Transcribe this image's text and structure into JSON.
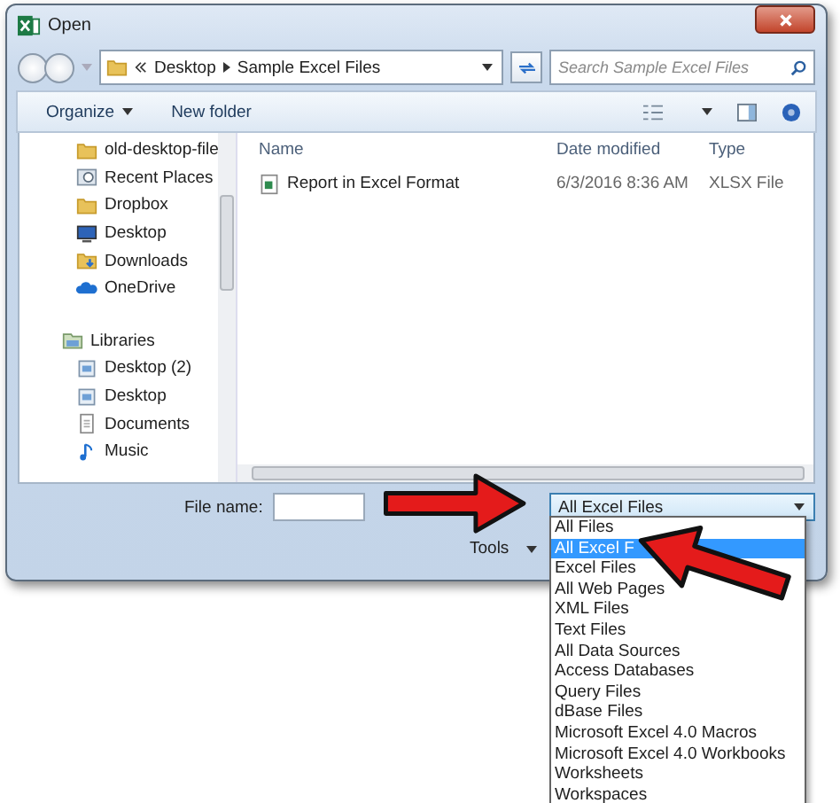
{
  "window": {
    "title": "Open"
  },
  "address": {
    "path": [
      "Desktop",
      "Sample Excel Files"
    ]
  },
  "search": {
    "placeholder": "Search Sample Excel Files"
  },
  "toolbar": [
    "Organize",
    "New folder"
  ],
  "sidebar": {
    "favorites": [
      {
        "label": "old-desktop-file",
        "kind": "folder"
      },
      {
        "label": "Recent Places",
        "kind": "recent"
      },
      {
        "label": "Dropbox",
        "kind": "folder"
      },
      {
        "label": "Desktop",
        "kind": "desktop"
      },
      {
        "label": "Downloads",
        "kind": "downloads"
      },
      {
        "label": "OneDrive",
        "kind": "cloud"
      }
    ],
    "libraries": {
      "label": "Libraries",
      "items": [
        {
          "label": "Desktop (2)",
          "kind": "library"
        },
        {
          "label": "Desktop",
          "kind": "library"
        },
        {
          "label": "Documents",
          "kind": "documents"
        },
        {
          "label": "Music",
          "kind": "music"
        }
      ]
    }
  },
  "columns": [
    "Name",
    "Date modified",
    "Type"
  ],
  "files": [
    {
      "name": "Report in Excel Format",
      "date": "6/3/2016 8:36 AM",
      "type": "XLSX File"
    }
  ],
  "file_name": {
    "label": "File name:"
  },
  "filter": {
    "value": "All Excel Files",
    "options": [
      {
        "label": "All Files",
        "selected": false
      },
      {
        "label": "All Excel F",
        "selected": true
      },
      {
        "label": "Excel Files",
        "selected": false
      },
      {
        "label": "All Web Pages",
        "selected": false
      },
      {
        "label": "XML Files",
        "selected": false
      },
      {
        "label": "Text Files",
        "selected": false
      },
      {
        "label": "All Data Sources",
        "selected": false
      },
      {
        "label": "Access Databases",
        "selected": false
      },
      {
        "label": "Query Files",
        "selected": false
      },
      {
        "label": "dBase Files",
        "selected": false
      },
      {
        "label": "Microsoft Excel 4.0 Macros",
        "selected": false
      },
      {
        "label": "Microsoft Excel 4.0 Workbooks",
        "selected": false
      },
      {
        "label": "Worksheets",
        "selected": false
      },
      {
        "label": "Workspaces",
        "selected": false
      }
    ]
  },
  "tools": "Tools"
}
